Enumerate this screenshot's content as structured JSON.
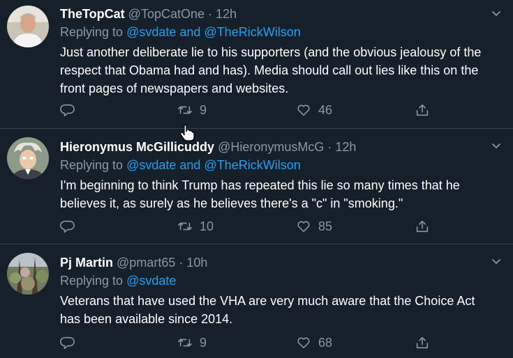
{
  "tweets": [
    {
      "name": "TheTopCat",
      "handle": "@TopCatOne",
      "dot": "·",
      "time": "12h",
      "replying_prefix": "Replying to",
      "replying_to": "@svdate and @TheRickWilson",
      "lines": [
        "Just another deliberate lie to his supporters (and the obvious jealousy of the",
        "respect that Obama had and has). Media should call out lies like this on the",
        "front pages of newspapers and websites."
      ],
      "retweets": "9",
      "likes": "46"
    },
    {
      "name": "Hieronymus McGillicuddy",
      "handle": "@HieronymusMcG",
      "dot": "·",
      "time": "12h",
      "replying_prefix": "Replying to",
      "replying_to": "@svdate and @TheRickWilson",
      "lines": [
        "I'm beginning to think Trump has repeated this lie so many times that he",
        "believes it, as surely as he believes there's a \"c\" in \"smoking.\""
      ],
      "retweets": "10",
      "likes": "85"
    },
    {
      "name": "Pj Martin",
      "handle": "@pmart65",
      "dot": "·",
      "time": "10h",
      "replying_prefix": "Replying to",
      "replying_to": "@svdate",
      "lines": [
        "Veterans that have used the VHA are very much aware that the Choice Act",
        "has been available since 2014."
      ],
      "retweets": "9",
      "likes": "68"
    }
  ],
  "icons": {
    "reply": "reply-icon",
    "retweet": "retweet-icon",
    "like": "heart-icon",
    "share": "share-icon",
    "caret": "chevron-down-icon",
    "cursor": "hand-cursor-icon"
  },
  "colors": {
    "background": "#15202b",
    "text": "#ffffff",
    "muted": "#8899a6",
    "link": "#1da1f2",
    "divider": "#38444d"
  }
}
